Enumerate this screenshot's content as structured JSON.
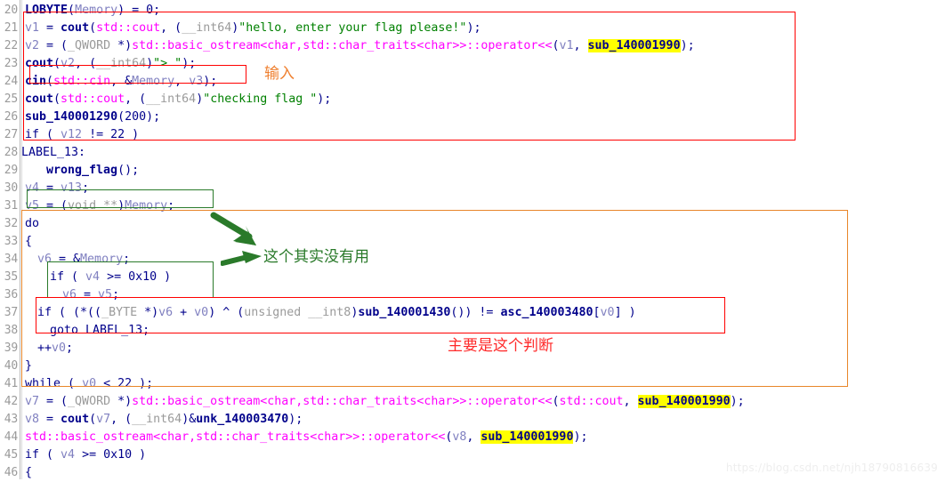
{
  "editor": {
    "kind": "decompiler-pseudocode-view",
    "first_line_number": 20,
    "last_line_number": 46,
    "line_numbers": [
      "20",
      "21",
      "22",
      "23",
      "24",
      "25",
      "26",
      "27",
      "28",
      "29",
      "30",
      "31",
      "32",
      "33",
      "34",
      "35",
      "36",
      "37",
      "38",
      "39",
      "40",
      "41",
      "42",
      "43",
      "44",
      "45",
      "46"
    ],
    "lines": [
      {
        "n": "20",
        "text": "  LOBYTE(Memory) = 0;"
      },
      {
        "n": "21",
        "text": "  v1 = cout(std::cout, (__int64)\"hello, enter your flag please!\");"
      },
      {
        "n": "22",
        "text": "  v2 = (_QWORD *)std::basic_ostream<char,std::char_traits<char>>::operator<<(v1, sub_140001990);"
      },
      {
        "n": "23",
        "text": "  cout(v2, (__int64)\"> \");"
      },
      {
        "n": "24",
        "text": "  cin(std::cin, &Memory, v3);"
      },
      {
        "n": "25",
        "text": "  cout(std::cout, (__int64)\"checking flag \");"
      },
      {
        "n": "26",
        "text": "  sub_140001290(200);"
      },
      {
        "n": "27",
        "text": "  if ( v12 != 22 )"
      },
      {
        "n": "28",
        "text": "LABEL_13:"
      },
      {
        "n": "29",
        "text": "    wrong_flag();"
      },
      {
        "n": "30",
        "text": "  v4 = v13;"
      },
      {
        "n": "31",
        "text": "  v5 = (void **)Memory;"
      },
      {
        "n": "32",
        "text": "  do"
      },
      {
        "n": "33",
        "text": "  {"
      },
      {
        "n": "34",
        "text": "    v6 = &Memory;"
      },
      {
        "n": "35",
        "text": "    if ( v4 >= 0x10 )"
      },
      {
        "n": "36",
        "text": "      v6 = v5;"
      },
      {
        "n": "37",
        "text": "    if ( (*((_BYTE *)v6 + v0) ^ (unsigned __int8)sub_140001430()) != asc_140003480[v0] )"
      },
      {
        "n": "38",
        "text": "      goto LABEL_13;"
      },
      {
        "n": "39",
        "text": "    ++v0;"
      },
      {
        "n": "40",
        "text": "  }"
      },
      {
        "n": "41",
        "text": "  while ( v0 < 22 );"
      },
      {
        "n": "42",
        "text": "  v7 = (_QWORD *)std::basic_ostream<char,std::char_traits<char>>::operator<<(std::cout, sub_140001990);"
      },
      {
        "n": "43",
        "text": "  v8 = cout(v7, (__int64)&unk_140003470);"
      },
      {
        "n": "44",
        "text": "  std::basic_ostream<char,std::char_traits<char>>::operator<<(v8, sub_140001990);"
      },
      {
        "n": "45",
        "text": "  if ( v4 >= 0x10 )"
      },
      {
        "n": "46",
        "text": "  {"
      }
    ],
    "highlighted_tokens": [
      "sub_140001990"
    ]
  },
  "annotations": [
    {
      "id": "input-note",
      "text": "输入",
      "color": "#ef8030",
      "target_line": "24"
    },
    {
      "id": "useless-note",
      "text": "这个其实没有用",
      "color": "#2a7a2a",
      "target_line": "35"
    },
    {
      "id": "main-check-note",
      "text": "主要是这个判断",
      "color": "#ff2a2a",
      "target_line": "37"
    }
  ],
  "boxes": [
    {
      "id": "red-outer-box",
      "color": "#ff0000",
      "lines": "21-27"
    },
    {
      "id": "red-cin-box",
      "color": "#ff0000",
      "lines": "24"
    },
    {
      "id": "green-v5-box",
      "color": "#2a7a2a",
      "lines": "31"
    },
    {
      "id": "orange-loop-box",
      "color": "#e8862a",
      "lines": "32-41"
    },
    {
      "id": "green-if-box",
      "color": "#2a7a2a",
      "lines": "35-36"
    },
    {
      "id": "red-if-box",
      "color": "#ff0000",
      "lines": "37-38"
    }
  ],
  "colors": {
    "keyword": "#00008b",
    "variable": "#8080c0",
    "std_type": "#ff00ff",
    "cast": "#9a9a9a",
    "string": "#008000",
    "highlight_bg": "#ffff00",
    "line_number": "#9a9a9a"
  },
  "watermark": {
    "text": "https://blog.csdn.net/njh18790816639"
  }
}
